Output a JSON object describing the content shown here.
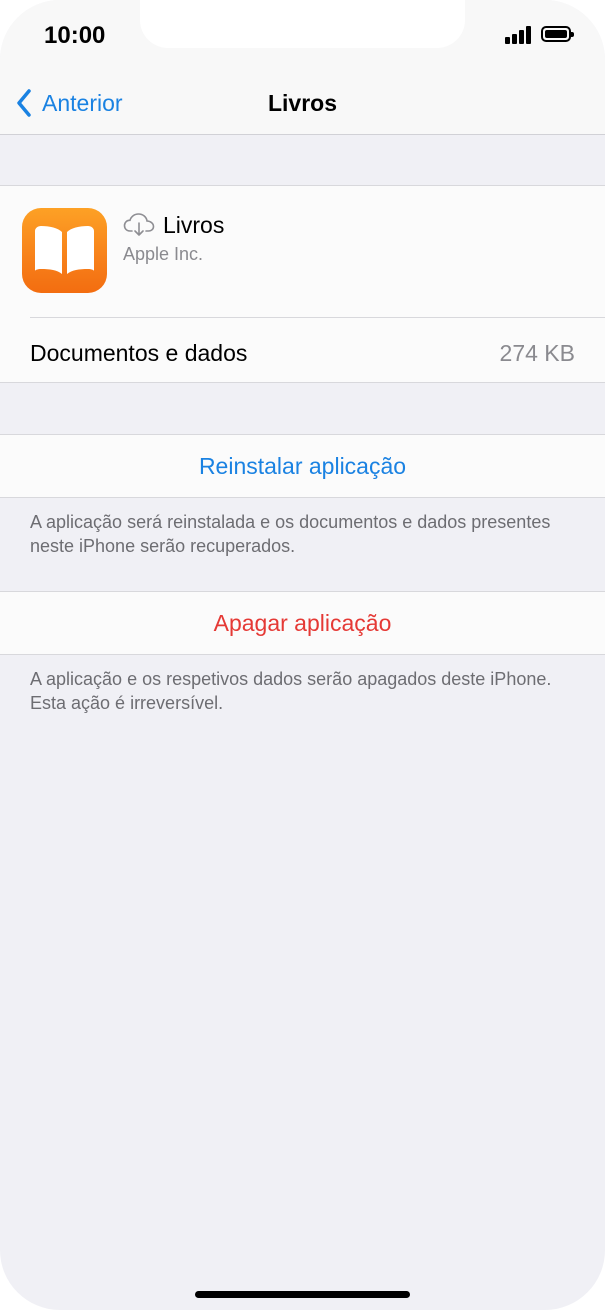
{
  "status_bar": {
    "time": "10:00"
  },
  "nav": {
    "back_label": "Anterior",
    "title": "Livros"
  },
  "app": {
    "name": "Livros",
    "developer": "Apple Inc.",
    "docs_label": "Documentos e dados",
    "docs_value": "274 KB"
  },
  "reinstall": {
    "label": "Reinstalar aplicação",
    "note": "A aplicação será reinstalada e os documentos e dados presentes neste iPhone serão recuperados."
  },
  "delete": {
    "label": "Apagar aplicação",
    "note": "A aplicação e os respetivos dados serão apagados deste iPhone. Esta ação é irreversível."
  },
  "colors": {
    "accent": "#1a82e2",
    "destructive": "#e53935",
    "icon_orange": "#f7801a"
  },
  "icons": [
    "back-chevron-icon",
    "books-app-icon",
    "cloud-download-icon",
    "signal-icon",
    "battery-icon"
  ]
}
